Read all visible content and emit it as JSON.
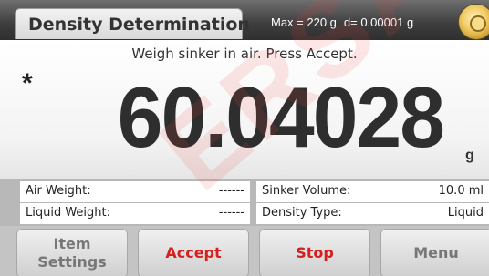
{
  "header": {
    "title": "Density Determination",
    "max": "Max = 220 g",
    "d": "d= 0.00001 g"
  },
  "display": {
    "prompt": "Weigh sinker in air. Press Accept.",
    "stable_indicator": "*",
    "weight": "60.04028",
    "unit": "g"
  },
  "info": {
    "air_weight_label": "Air Weight:",
    "air_weight_value": "------",
    "sinker_volume_label": "Sinker Volume:",
    "sinker_volume_value": "10.0 ml",
    "liquid_weight_label": "Liquid Weight:",
    "liquid_weight_value": "------",
    "density_type_label": "Density Type:",
    "density_type_value": "Liquid"
  },
  "buttons": {
    "item_settings_line1": "Item",
    "item_settings_line2": "Settings",
    "accept": "Accept",
    "stop": "Stop",
    "menu": "Menu"
  },
  "watermark": "ERSA",
  "colors": {
    "accent_red": "#d42020",
    "header_bg": "#3d3d3d",
    "level_icon": "#f0c860"
  },
  "icons": {
    "level_indicator": "level-bubble-icon"
  }
}
